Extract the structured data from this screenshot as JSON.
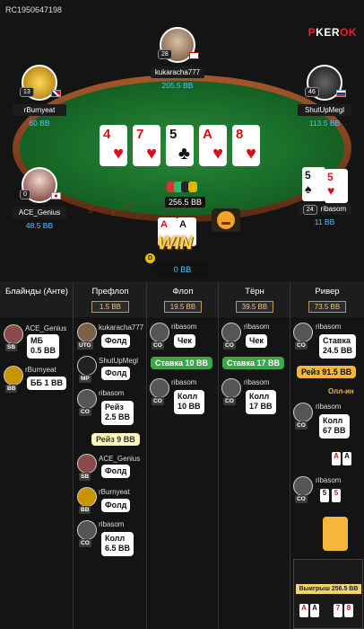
{
  "hand_id": "RC1950647198",
  "brand": {
    "prefix": "P",
    "mid": "KER",
    "suffix": "OK"
  },
  "colors": {
    "accent_blue": "#5bc0f2",
    "felt": "#186a27",
    "rail": "#a4582b",
    "win_gold": "#ffd64a"
  },
  "table_text": "USER",
  "players": {
    "top": {
      "name": "kukaracha777",
      "level": "28",
      "stack": "205.5 BB"
    },
    "left_upper": {
      "name": "rBurnyeat",
      "level": "13",
      "stack": "60 BB"
    },
    "right_upper": {
      "name": "ShutUpMegl",
      "level": "46",
      "stack": "113.5 BB"
    },
    "left_lower": {
      "name": "ACE_Genius",
      "level": "0",
      "stack": "48.5 BB"
    },
    "right_lower": {
      "name": "ribasom",
      "level": "24",
      "stack": "11 BB"
    },
    "hero": {
      "stack": "0 BB",
      "card1": "A",
      "card2": "A"
    }
  },
  "board": [
    {
      "rank": "4",
      "suit": "♥"
    },
    {
      "rank": "7",
      "suit": "♥"
    },
    {
      "rank": "5",
      "suit": "♣"
    },
    {
      "rank": "A",
      "suit": "♥"
    },
    {
      "rank": "8",
      "suit": "♥"
    }
  ],
  "pot": "256.5 BB",
  "win_label": "WIN",
  "dealer": "D",
  "ribasom_cards": [
    {
      "rank": "5",
      "suit": "♠"
    },
    {
      "rank": "5",
      "suit": "♥"
    }
  ],
  "columns": [
    {
      "title": "Блайнды (Анте)",
      "value": ""
    },
    {
      "title": "Префлоп",
      "value": "1.5 BB"
    },
    {
      "title": "Флоп",
      "value": "19.5 BB"
    },
    {
      "title": "Тёрн",
      "value": "39.5 BB"
    },
    {
      "title": "Ривер",
      "value": "73.5 BB"
    }
  ],
  "history": {
    "blinds": [
      {
        "name": "ACE_Genius",
        "pos": "SB",
        "action": "МБ\n0.5 BB"
      },
      {
        "name": "rBurnyeat",
        "pos": "BB",
        "action": "ББ 1 BB"
      }
    ],
    "preflop": [
      {
        "name": "kukaracha777",
        "pos": "UTG",
        "action": "Фолд"
      },
      {
        "name": "ShutUpMegl",
        "pos": "MP",
        "action": "Фолд"
      },
      {
        "name": "ribasom",
        "pos": "CO",
        "action": "Рейз\n2.5 BB"
      },
      {
        "name": "",
        "pos": "",
        "action": "Рейз 9 BB"
      },
      {
        "name": "ACE_Genius",
        "pos": "SB",
        "action": "Фолд"
      },
      {
        "name": "rBurnyeat",
        "pos": "BB",
        "action": "Фолд"
      },
      {
        "name": "ribasom",
        "pos": "CO",
        "action": "Колл\n6.5 BB"
      }
    ],
    "flop": [
      {
        "name": "ribasom",
        "pos": "CO",
        "action": "Чек"
      },
      {
        "name": "",
        "pos": "",
        "action": "Ставка 10 BB"
      },
      {
        "name": "ribasom",
        "pos": "CO",
        "action": "Колл\n10 BB"
      }
    ],
    "turn": [
      {
        "name": "ribasom",
        "pos": "CO",
        "action": "Чек"
      },
      {
        "name": "",
        "pos": "",
        "action": "Ставка 17 BB"
      },
      {
        "name": "ribasom",
        "pos": "CO",
        "action": "Колл\n17 BB"
      }
    ],
    "river": [
      {
        "name": "ribasom",
        "pos": "CO",
        "action": "Ставка\n24.5 BB"
      },
      {
        "name": "",
        "pos": "",
        "action": "Рейз 91.5 BB"
      },
      {
        "name": "",
        "pos": "",
        "action": "Олл-ин"
      },
      {
        "name": "ribasom",
        "pos": "CO",
        "action": "Колл\n67 BB"
      },
      {
        "name": "ribasom",
        "pos": "CO",
        "action": ""
      }
    ]
  },
  "winnings": "Выигрыш 256.5 BB",
  "final_cards": [
    "A",
    "A",
    "7",
    "8"
  ]
}
